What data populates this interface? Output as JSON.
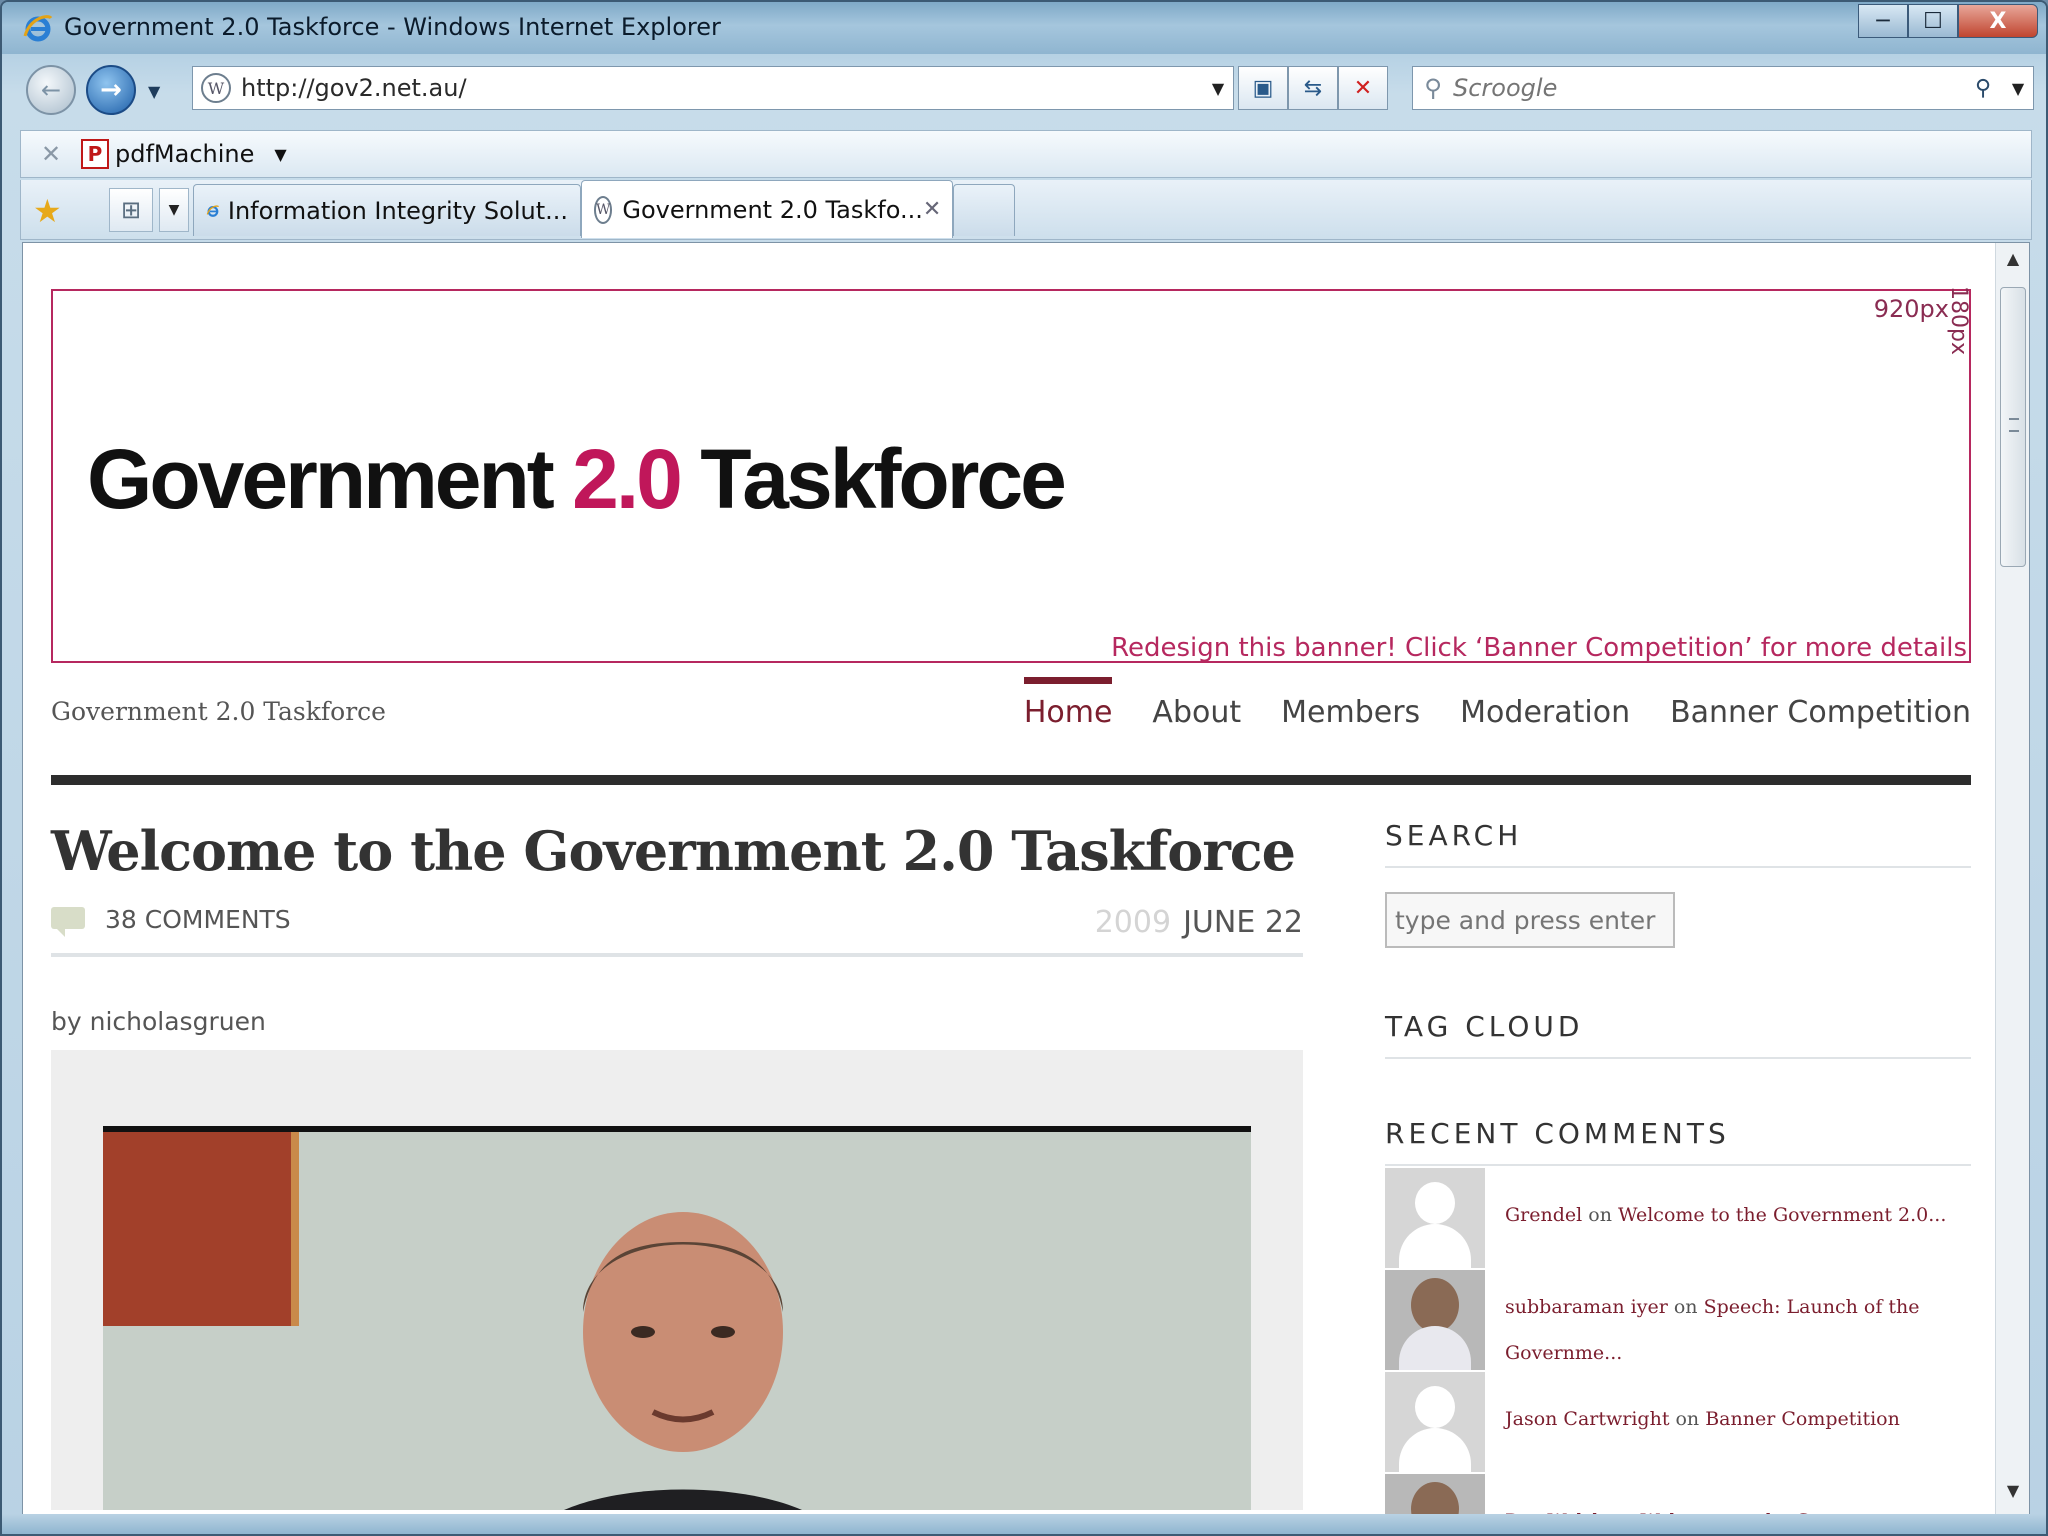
{
  "window": {
    "title": "Government 2.0 Taskforce - Windows Internet Explorer",
    "controls": {
      "minimize": "─",
      "maximize": "☐",
      "close": "X"
    }
  },
  "nav": {
    "back": "←",
    "forward": "→",
    "url": "http://gov2.net.au/",
    "search_placeholder": "Scroogle"
  },
  "toolbar": {
    "pdf_label": "pdfMachine"
  },
  "tabs": [
    {
      "label": "Information Integrity Solut..."
    },
    {
      "label": "Government 2.0 Taskfo...",
      "active": true
    }
  ],
  "banner": {
    "width_label": "920px",
    "height_label": "180px",
    "logo_part1": "Government ",
    "logo_accent": "2.0",
    "logo_part2": " Taskforce",
    "promo": "Redesign this banner! Click ‘Banner Competition’ for more details"
  },
  "site": {
    "name": "Government 2.0 Taskforce",
    "menu": [
      {
        "label": "Home",
        "active": true
      },
      {
        "label": "About"
      },
      {
        "label": "Members"
      },
      {
        "label": "Moderation"
      },
      {
        "label": "Banner Competition"
      }
    ]
  },
  "post": {
    "title": "Welcome to the Government 2.0 Taskforce",
    "comments": "38 COMMENTS",
    "year": "2009",
    "date": "JUNE 22",
    "byline": "by nicholasgruen"
  },
  "sidebar": {
    "search_title": "SEARCH",
    "search_placeholder": "type and press enter",
    "tag_title": "TAG CLOUD",
    "recent_title": "RECENT COMMENTS",
    "recent": [
      {
        "author": "Grendel",
        "on": " on ",
        "post": "Welcome to the Government 2.0..."
      },
      {
        "author": "subbaraman iyer",
        "on": " on ",
        "post": "Speech: Launch of the Governme..."
      },
      {
        "author": "Jason Cartwright",
        "on": " on ",
        "post": "Banner Competition"
      },
      {
        "author": "Des Walsh",
        "on": " on ",
        "post": "Welcome to the Government"
      }
    ]
  },
  "colors": {
    "accent": "#c0175a",
    "banner_border": "#b6285f",
    "nav_active": "#7b1e2e"
  }
}
